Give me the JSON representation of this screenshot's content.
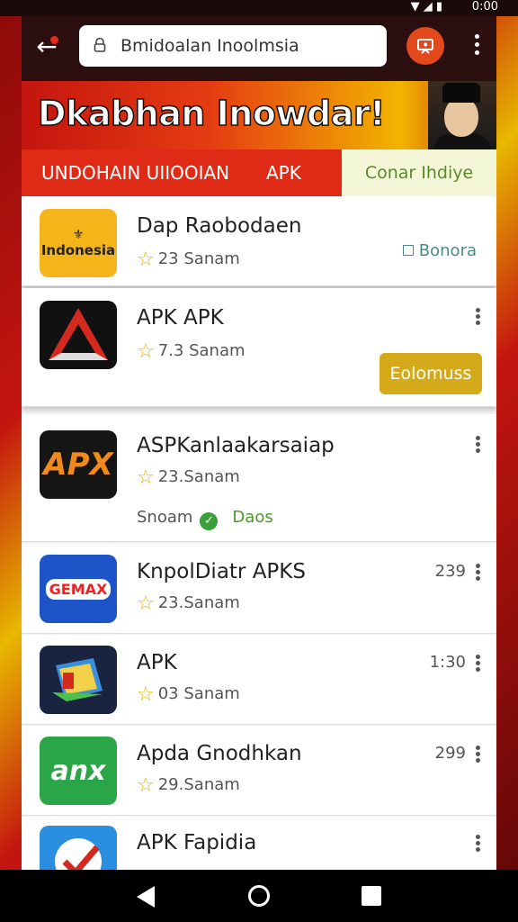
{
  "status_bar": {
    "time": "0:00"
  },
  "browser": {
    "url": "Bmidoalan Inoolmsia",
    "back_icon": "arrow-left-icon",
    "lock_icon": "lock-icon",
    "cast_icon": "cast-icon",
    "menu_icon": "more-vert-icon"
  },
  "banner": {
    "title": "Dkabhan Inowdar!"
  },
  "tabs": {
    "left_label": "UNDOHAIN UIIOOIAN",
    "middle_label": "APK",
    "right_label": "Conar Ihdiye"
  },
  "apps": [
    {
      "name": "Dap Raobodaen",
      "rating": "23 Sanam",
      "badge": "Bonora",
      "icon_text": "Indonesia"
    },
    {
      "name": "APK APK",
      "rating": "7.3 Sanam",
      "button": "Eolomuss"
    },
    {
      "name": "ASPKanlaakarsaiap",
      "rating": "23.Sanam",
      "sub_left": "Snoam",
      "sub_right": "Daos",
      "icon_text": "APX"
    },
    {
      "name": "KnpolDiatr APKS",
      "rating": "23.Sanam",
      "size": "239",
      "icon_text": "GEMAX"
    },
    {
      "name": "APK",
      "rating": "03 Sanam",
      "size": "1:30"
    },
    {
      "name": "Apda Gnodhkan",
      "rating": "29.Sanam",
      "size": "299",
      "icon_text": "anx"
    },
    {
      "name": "APK Fapidia",
      "rating": ""
    }
  ],
  "colors": {
    "brand_red": "#df2a16",
    "accent_gold": "#d4aa1a",
    "tab_light": "#f4f6d8"
  }
}
